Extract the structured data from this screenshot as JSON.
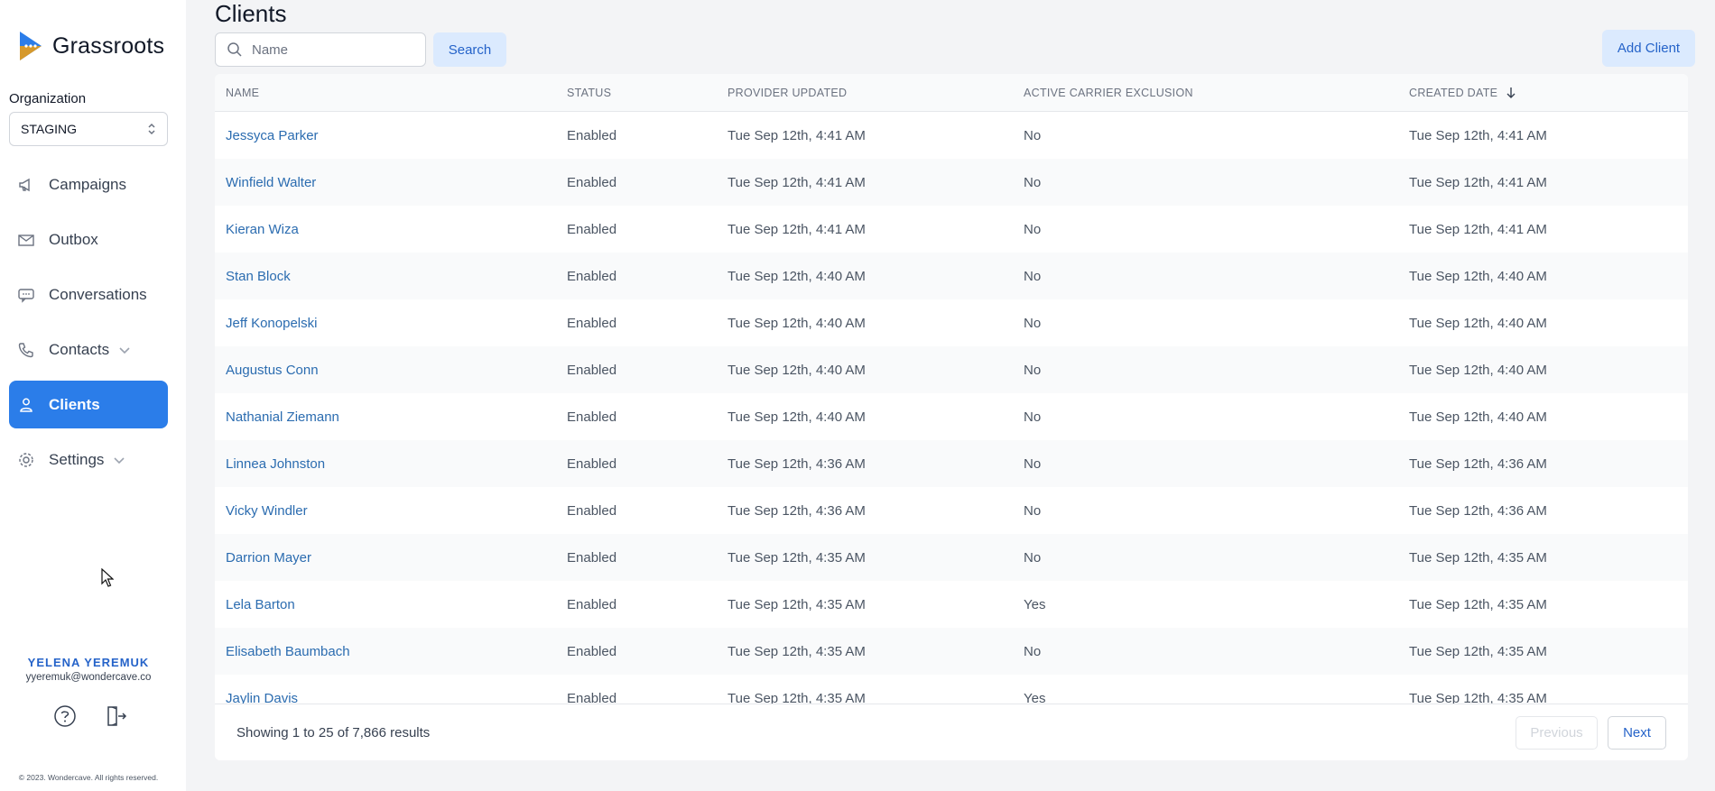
{
  "app": {
    "name": "Grassroots"
  },
  "sidebar": {
    "org_label": "Organization",
    "org_value": "STAGING",
    "items": [
      {
        "label": "Campaigns",
        "icon": "megaphone-icon"
      },
      {
        "label": "Outbox",
        "icon": "envelope-icon"
      },
      {
        "label": "Conversations",
        "icon": "chat-icon"
      },
      {
        "label": "Contacts",
        "icon": "phone-icon"
      },
      {
        "label": "Clients",
        "icon": "user-icon"
      },
      {
        "label": "Settings",
        "icon": "gear-icon"
      }
    ],
    "user_name": "YELENA YEREMUK",
    "user_email": "yyeremuk@wondercave.co",
    "copyright": "© 2023. Wondercave. All rights reserved."
  },
  "main": {
    "title": "Clients",
    "search_placeholder": "Name",
    "search_button": "Search",
    "add_button": "Add Client"
  },
  "table": {
    "headers": [
      "NAME",
      "STATUS",
      "PROVIDER UPDATED",
      "ACTIVE CARRIER EXCLUSION",
      "CREATED DATE"
    ],
    "rows": [
      [
        "Jessyca Parker",
        "Enabled",
        "Tue Sep 12th, 4:41 AM",
        "No",
        "Tue Sep 12th, 4:41 AM"
      ],
      [
        "Winfield Walter",
        "Enabled",
        "Tue Sep 12th, 4:41 AM",
        "No",
        "Tue Sep 12th, 4:41 AM"
      ],
      [
        "Kieran Wiza",
        "Enabled",
        "Tue Sep 12th, 4:41 AM",
        "No",
        "Tue Sep 12th, 4:41 AM"
      ],
      [
        "Stan Block",
        "Enabled",
        "Tue Sep 12th, 4:40 AM",
        "No",
        "Tue Sep 12th, 4:40 AM"
      ],
      [
        "Jeff Konopelski",
        "Enabled",
        "Tue Sep 12th, 4:40 AM",
        "No",
        "Tue Sep 12th, 4:40 AM"
      ],
      [
        "Augustus Conn",
        "Enabled",
        "Tue Sep 12th, 4:40 AM",
        "No",
        "Tue Sep 12th, 4:40 AM"
      ],
      [
        "Nathanial Ziemann",
        "Enabled",
        "Tue Sep 12th, 4:40 AM",
        "No",
        "Tue Sep 12th, 4:40 AM"
      ],
      [
        "Linnea Johnston",
        "Enabled",
        "Tue Sep 12th, 4:36 AM",
        "No",
        "Tue Sep 12th, 4:36 AM"
      ],
      [
        "Vicky Windler",
        "Enabled",
        "Tue Sep 12th, 4:36 AM",
        "No",
        "Tue Sep 12th, 4:36 AM"
      ],
      [
        "Darrion Mayer",
        "Enabled",
        "Tue Sep 12th, 4:35 AM",
        "No",
        "Tue Sep 12th, 4:35 AM"
      ],
      [
        "Lela Barton",
        "Enabled",
        "Tue Sep 12th, 4:35 AM",
        "Yes",
        "Tue Sep 12th, 4:35 AM"
      ],
      [
        "Elisabeth Baumbach",
        "Enabled",
        "Tue Sep 12th, 4:35 AM",
        "No",
        "Tue Sep 12th, 4:35 AM"
      ],
      [
        "Jaylin Davis",
        "Enabled",
        "Tue Sep 12th, 4:35 AM",
        "Yes",
        "Tue Sep 12th, 4:35 AM"
      ]
    ],
    "results_text": "Showing 1 to 25 of 7,866 results",
    "prev_label": "Previous",
    "next_label": "Next"
  },
  "colors": {
    "accent": "#2b7de9",
    "link": "#2b6cb0",
    "button_bg": "#dbeafe"
  }
}
